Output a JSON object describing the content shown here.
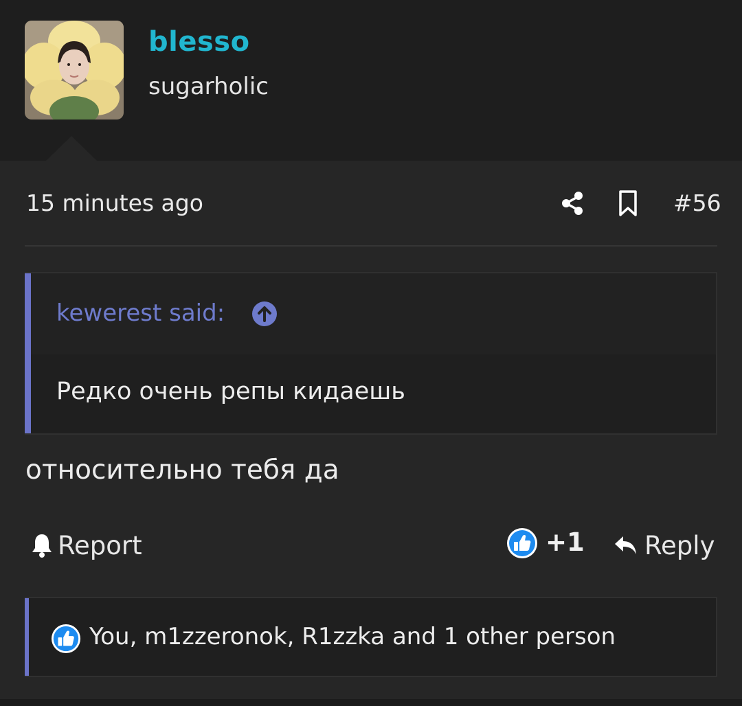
{
  "user": {
    "name": "blesso",
    "title": "sugarholic",
    "name_color": "#21b6cf"
  },
  "post": {
    "time": "15 minutes ago",
    "number": "#56",
    "quote": {
      "attribution": "kewerest said:",
      "text": "Редко очень репы кидаешь"
    },
    "text": "относительно тебя да"
  },
  "actions": {
    "report_label": "Report",
    "like_count": "+1",
    "reply_label": "Reply"
  },
  "reactions": {
    "summary": "You, m1zzeronok, R1zzka and 1 other person"
  },
  "icons": [
    "share-icon",
    "bookmark-icon",
    "arrow-up-circle-icon",
    "bell-icon",
    "thumbs-up-icon",
    "reply-arrow-icon"
  ],
  "colors": {
    "accent": "#6b73c8",
    "quote_attribution": "#6e7bcc",
    "like_blue": "#1d8bf0"
  }
}
